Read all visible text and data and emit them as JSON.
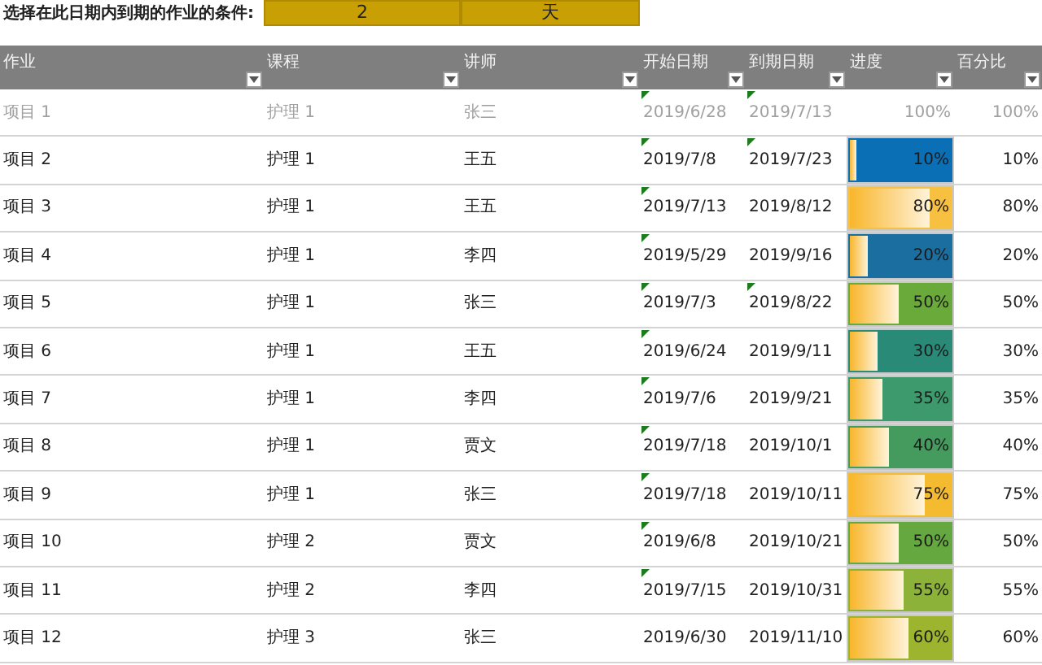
{
  "condition": {
    "label": "选择在此日期内到期的作业的条件:",
    "value": "2",
    "unit": "天"
  },
  "columns": [
    {
      "label": "作业"
    },
    {
      "label": "课程"
    },
    {
      "label": "讲师"
    },
    {
      "label": "开始日期"
    },
    {
      "label": "到期日期"
    },
    {
      "label": "进度"
    },
    {
      "label": "百分比"
    }
  ],
  "rows": [
    {
      "task": "项目 1",
      "course": "护理 1",
      "teacher": "张三",
      "start": {
        "text": "2019/6/28",
        "flagged": true
      },
      "due": {
        "text": "2019/7/13",
        "flagged": true
      },
      "completed": true,
      "progress": {
        "text": "100%"
      },
      "percent": "100%"
    },
    {
      "task": "项目 2",
      "course": "护理 1",
      "teacher": "王五",
      "start": {
        "text": "2019/7/8",
        "flagged": true
      },
      "due": {
        "text": "2019/7/23",
        "flagged": true
      },
      "completed": false,
      "progress": {
        "text": "10%",
        "level": 0.1,
        "color": "#0a6fb5"
      },
      "percent": "10%"
    },
    {
      "task": "项目 3",
      "course": "护理 1",
      "teacher": "王五",
      "start": {
        "text": "2019/7/13",
        "flagged": true
      },
      "due": {
        "text": "2019/8/12",
        "flagged": false
      },
      "completed": false,
      "progress": {
        "text": "80%",
        "level": 0.8,
        "color": "#f7c040"
      },
      "percent": "80%"
    },
    {
      "task": "项目 4",
      "course": "护理 1",
      "teacher": "李四",
      "start": {
        "text": "2019/5/29",
        "flagged": true
      },
      "due": {
        "text": "2019/9/16",
        "flagged": false
      },
      "completed": false,
      "progress": {
        "text": "20%",
        "level": 0.2,
        "color": "#1b6fa0"
      },
      "percent": "20%"
    },
    {
      "task": "项目 5",
      "course": "护理 1",
      "teacher": "张三",
      "start": {
        "text": "2019/7/3",
        "flagged": true
      },
      "due": {
        "text": "2019/8/22",
        "flagged": true
      },
      "completed": false,
      "progress": {
        "text": "50%",
        "level": 0.5,
        "color": "#6aaa3a"
      },
      "percent": "50%"
    },
    {
      "task": "项目 6",
      "course": "护理 1",
      "teacher": "王五",
      "start": {
        "text": "2019/6/24",
        "flagged": true
      },
      "due": {
        "text": "2019/9/11",
        "flagged": false
      },
      "completed": false,
      "progress": {
        "text": "30%",
        "level": 0.3,
        "color": "#2a8a78"
      },
      "percent": "30%"
    },
    {
      "task": "项目 7",
      "course": "护理 1",
      "teacher": "李四",
      "start": {
        "text": "2019/7/6",
        "flagged": true
      },
      "due": {
        "text": "2019/9/21",
        "flagged": false
      },
      "completed": false,
      "progress": {
        "text": "35%",
        "level": 0.35,
        "color": "#3d9a6c"
      },
      "percent": "35%"
    },
    {
      "task": "项目 8",
      "course": "护理 1",
      "teacher": "贾文",
      "start": {
        "text": "2019/7/18",
        "flagged": true
      },
      "due": {
        "text": "2019/10/1",
        "flagged": false
      },
      "completed": false,
      "progress": {
        "text": "40%",
        "level": 0.4,
        "color": "#459a5e"
      },
      "percent": "40%"
    },
    {
      "task": "项目 9",
      "course": "护理 1",
      "teacher": "张三",
      "start": {
        "text": "2019/7/18",
        "flagged": true
      },
      "due": {
        "text": "2019/10/11",
        "flagged": false
      },
      "completed": false,
      "progress": {
        "text": "75%",
        "level": 0.75,
        "color": "#f5bb30"
      },
      "percent": "75%"
    },
    {
      "task": "项目 10",
      "course": "护理 2",
      "teacher": "贾文",
      "start": {
        "text": "2019/6/8",
        "flagged": true
      },
      "due": {
        "text": "2019/10/21",
        "flagged": false
      },
      "completed": false,
      "progress": {
        "text": "50%",
        "level": 0.5,
        "color": "#65a840"
      },
      "percent": "50%"
    },
    {
      "task": "项目 11",
      "course": "护理 2",
      "teacher": "李四",
      "start": {
        "text": "2019/7/15",
        "flagged": true
      },
      "due": {
        "text": "2019/10/31",
        "flagged": false
      },
      "completed": false,
      "progress": {
        "text": "55%",
        "level": 0.55,
        "color": "#8cb23a"
      },
      "percent": "55%"
    },
    {
      "task": "项目 12",
      "course": "护理 3",
      "teacher": "张三",
      "start": {
        "text": "2019/6/30",
        "flagged": false
      },
      "due": {
        "text": "2019/11/10",
        "flagged": false
      },
      "completed": false,
      "progress": {
        "text": "60%",
        "level": 0.6,
        "color": "#9db52e"
      },
      "percent": "60%"
    }
  ]
}
